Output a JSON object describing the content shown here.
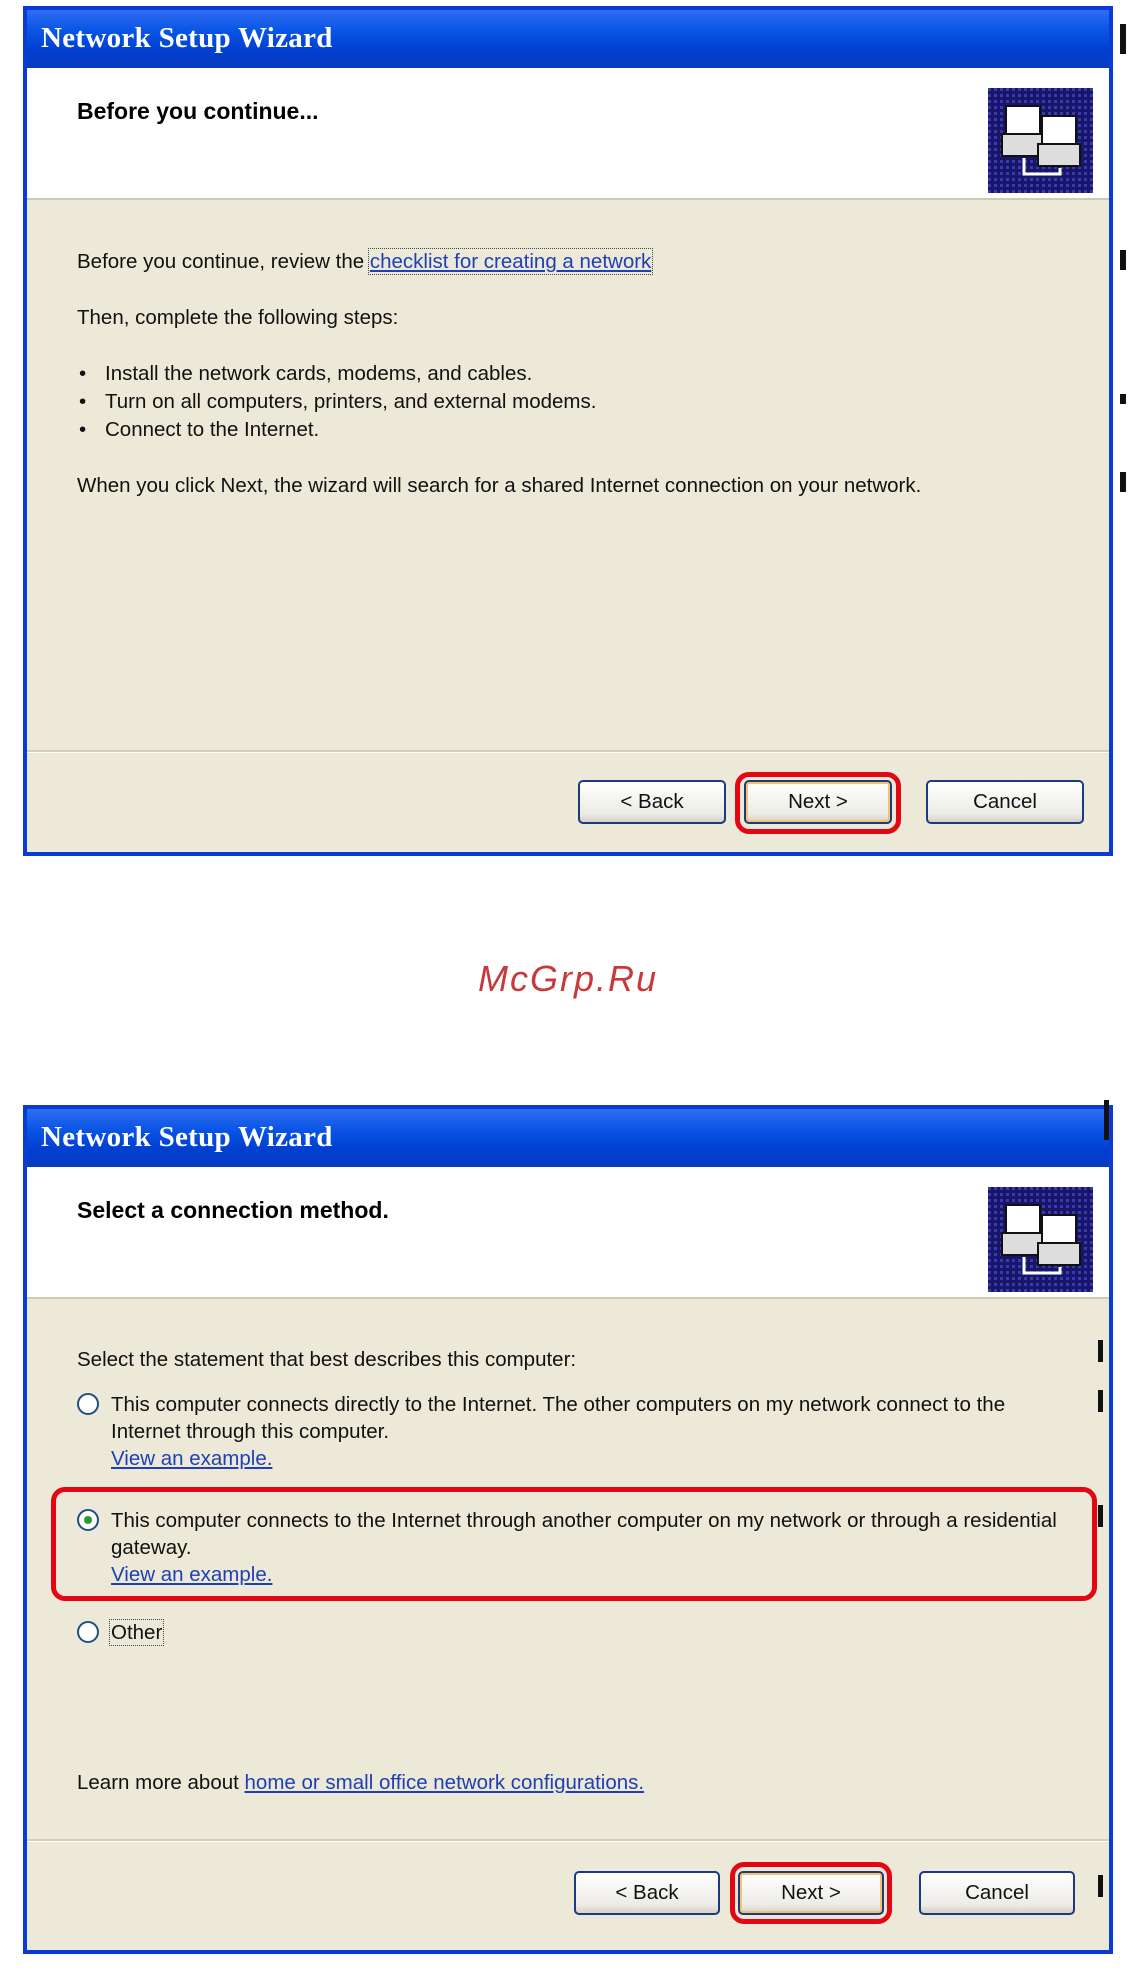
{
  "watermark": "McGrp.Ru",
  "dialog1": {
    "title": "Network Setup Wizard",
    "header": "Before you continue...",
    "icon": "network-computers-icon",
    "intro_prefix": "Before you continue, review the",
    "intro_link": "checklist for creating a network",
    "then_text": "Then, complete the following steps:",
    "steps": [
      "Install the network cards, modems, and cables.",
      "Turn on all computers, printers, and external modems.",
      "Connect to the Internet."
    ],
    "next_info": "When you click Next, the wizard will search for a shared Internet connection on your network.",
    "buttons": {
      "back": "< Back",
      "next": "Next >",
      "cancel": "Cancel"
    }
  },
  "dialog2": {
    "title": "Network Setup Wizard",
    "header": "Select a connection method.",
    "icon": "network-computers-icon",
    "prompt": "Select the statement that best describes this computer:",
    "options": [
      {
        "label": "This computer connects directly to the Internet. The other computers on my network connect to the Internet through this computer.",
        "link": "View an example.",
        "selected": false
      },
      {
        "label": "This computer connects to the Internet through another computer on my network or through a residential gateway.",
        "link": "View an example.",
        "selected": true
      },
      {
        "label": "Other",
        "selected": false
      }
    ],
    "learn_prefix": "Learn more about",
    "learn_link": "home or small office network configurations.",
    "buttons": {
      "back": "< Back",
      "next": "Next >",
      "cancel": "Cancel"
    }
  },
  "colors": {
    "highlight": "#e30613",
    "titlebar": "#0a55e6",
    "dialog_bg": "#ece9d8"
  }
}
